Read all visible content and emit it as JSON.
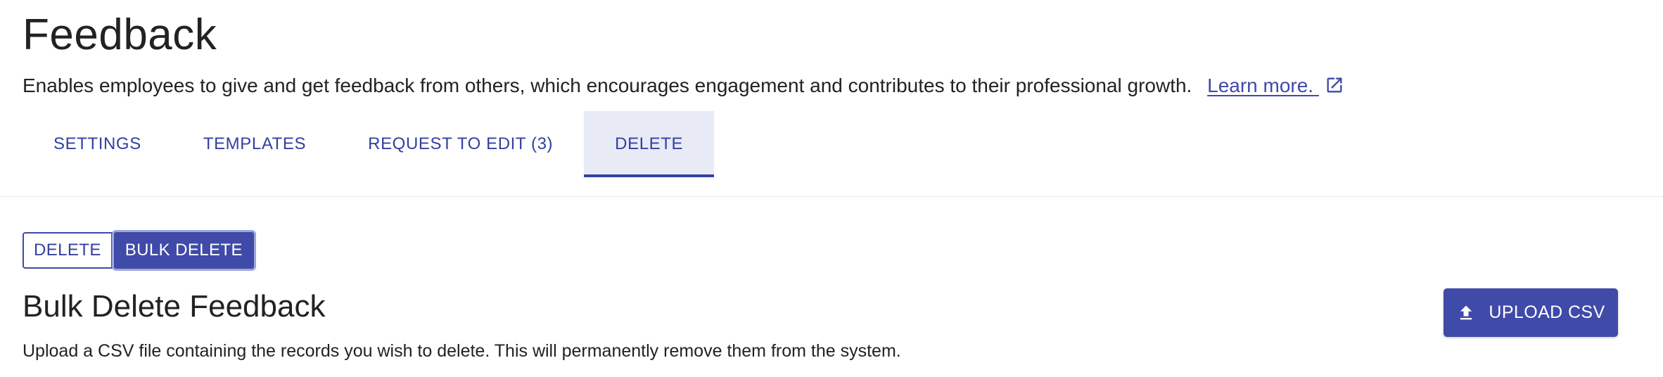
{
  "header": {
    "title": "Feedback",
    "description": "Enables employees to give and get feedback from others, which encourages engagement and contributes to their professional growth.",
    "learn_more": "Learn more."
  },
  "tabs": [
    {
      "label": "SETTINGS",
      "active": false
    },
    {
      "label": "TEMPLATES",
      "active": false
    },
    {
      "label": "REQUEST TO EDIT (3)",
      "active": false
    },
    {
      "label": "DELETE",
      "active": true
    }
  ],
  "mode_toggle": {
    "delete_label": "DELETE",
    "bulk_delete_label": "BULK DELETE",
    "selected": "BULK DELETE"
  },
  "section": {
    "title": "Bulk Delete Feedback",
    "description": "Upload a CSV file containing the records you wish to delete. This will permanently remove them from the system.",
    "upload_label": "UPLOAD CSV"
  },
  "icons": {
    "learn_more": "external-link-icon",
    "upload": "upload-icon"
  },
  "colors": {
    "accent": "#3f4aa9",
    "tab_active_bg": "#e8eaf6",
    "text": "#222222"
  }
}
